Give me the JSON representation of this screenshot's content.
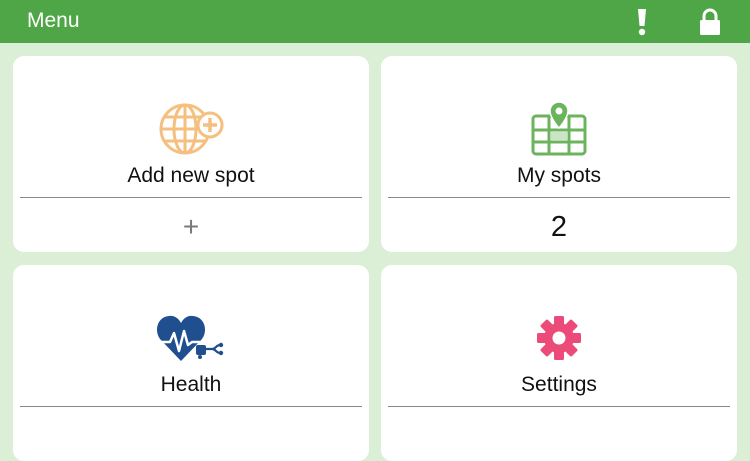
{
  "header": {
    "title": "Menu",
    "alert_icon": "exclamation-icon",
    "lock_icon": "lock-icon"
  },
  "tiles": [
    {
      "label": "Add new spot",
      "value": "+",
      "icon": "globe-plus-icon",
      "color": "#f5bf7f"
    },
    {
      "label": "My spots",
      "value": "2",
      "icon": "map-pin-icon",
      "color": "#6cb35d"
    },
    {
      "label": "Health",
      "value": "",
      "icon": "heart-health-icon",
      "color": "#1f4f8f"
    },
    {
      "label": "Settings",
      "value": "",
      "icon": "gear-icon",
      "color": "#ec4b7a"
    }
  ],
  "colors": {
    "header_bg": "#4fa646",
    "page_bg": "#dbeed6"
  }
}
